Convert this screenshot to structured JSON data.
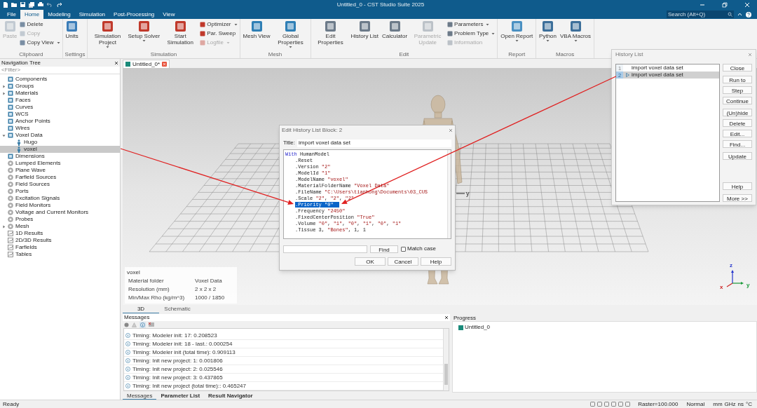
{
  "window": {
    "title": "Untitled_0 - CST Studio Suite 2025",
    "search_placeholder": "Search (Alt+Q)"
  },
  "ribbon_tabs": [
    {
      "label": "File",
      "selected": false
    },
    {
      "label": "Home",
      "selected": true
    },
    {
      "label": "Modeling",
      "selected": false
    },
    {
      "label": "Simulation",
      "selected": false
    },
    {
      "label": "Post-Processing",
      "selected": false
    },
    {
      "label": "View",
      "selected": false
    }
  ],
  "ribbon_groups": [
    {
      "label": "Clipboard",
      "items": [
        {
          "label": "Paste",
          "kind": "large",
          "disabled": true,
          "menu": false
        },
        {
          "label": "Delete",
          "kind": "small",
          "disabled": false,
          "menu": false
        },
        {
          "label": "Copy",
          "kind": "small",
          "disabled": true,
          "menu": false
        },
        {
          "label": "Copy View",
          "kind": "small",
          "disabled": false,
          "menu": true
        }
      ]
    },
    {
      "label": "Settings",
      "items": [
        {
          "label": "Units",
          "kind": "large",
          "disabled": false,
          "menu": false
        }
      ]
    },
    {
      "label": "Simulation",
      "items": [
        {
          "label": "Simulation Project",
          "kind": "large",
          "disabled": false,
          "menu": true
        },
        {
          "label": "Setup Solver",
          "kind": "large",
          "disabled": false,
          "menu": true
        },
        {
          "label": "Start Simulation",
          "kind": "large",
          "disabled": false,
          "menu": false
        },
        {
          "label": "Optimizer",
          "kind": "small",
          "disabled": false,
          "menu": true
        },
        {
          "label": "Par. Sweep",
          "kind": "small",
          "disabled": false,
          "menu": false
        },
        {
          "label": "Logfile",
          "kind": "small",
          "disabled": true,
          "menu": true
        }
      ]
    },
    {
      "label": "Mesh",
      "items": [
        {
          "label": "Mesh View",
          "kind": "large",
          "disabled": false,
          "menu": false
        },
        {
          "label": "Global Properties",
          "kind": "large",
          "disabled": false,
          "menu": true
        }
      ]
    },
    {
      "label": "Edit",
      "items": [
        {
          "label": "Edit Properties",
          "kind": "large",
          "disabled": false,
          "menu": false
        },
        {
          "label": "History List",
          "kind": "large",
          "disabled": false,
          "menu": false
        },
        {
          "label": "Calculator",
          "kind": "large",
          "disabled": false,
          "menu": false
        },
        {
          "label": "Parametric Update",
          "kind": "large",
          "disabled": true,
          "menu": false
        },
        {
          "label": "Parameters",
          "kind": "small",
          "disabled": false,
          "menu": true
        },
        {
          "label": "Problem Type",
          "kind": "small",
          "disabled": false,
          "menu": true
        },
        {
          "label": "Information",
          "kind": "small",
          "disabled": true,
          "menu": false
        }
      ]
    },
    {
      "label": "Report",
      "items": [
        {
          "label": "Open Report",
          "kind": "large",
          "disabled": false,
          "menu": true
        }
      ]
    },
    {
      "label": "Macros",
      "items": [
        {
          "label": "Python",
          "kind": "large",
          "disabled": false,
          "menu": true
        },
        {
          "label": "VBA Macros",
          "kind": "large",
          "disabled": false,
          "menu": true
        }
      ]
    }
  ],
  "navigation_tree": {
    "title": "Navigation Tree",
    "filter_placeholder": "<Filter>",
    "items": [
      {
        "label": "Components",
        "kind": "folder",
        "selected": false
      },
      {
        "label": "Groups",
        "kind": "folder",
        "selected": false,
        "expanded": false
      },
      {
        "label": "Materials",
        "kind": "folder",
        "selected": false,
        "expanded": false
      },
      {
        "label": "Faces",
        "kind": "folder",
        "selected": false
      },
      {
        "label": "Curves",
        "kind": "folder",
        "selected": false
      },
      {
        "label": "WCS",
        "kind": "folder",
        "selected": false
      },
      {
        "label": "Anchor Points",
        "kind": "folder",
        "selected": false
      },
      {
        "label": "Wires",
        "kind": "folder",
        "selected": false
      },
      {
        "label": "Voxel Data",
        "kind": "folder",
        "selected": false,
        "expanded": true,
        "children": [
          {
            "label": "Hugo",
            "kind": "voxel",
            "selected": false
          },
          {
            "label": "voxel",
            "kind": "voxel",
            "selected": true
          }
        ]
      },
      {
        "label": "Dimensions",
        "kind": "folder",
        "selected": false
      },
      {
        "label": "Lumped Elements",
        "kind": "source",
        "selected": false
      },
      {
        "label": "Plane Wave",
        "kind": "source",
        "selected": false
      },
      {
        "label": "Farfield Sources",
        "kind": "source",
        "selected": false
      },
      {
        "label": "Field Sources",
        "kind": "source",
        "selected": false
      },
      {
        "label": "Ports",
        "kind": "source",
        "selected": false
      },
      {
        "label": "Excitation Signals",
        "kind": "source",
        "selected": false
      },
      {
        "label": "Field Monitors",
        "kind": "source",
        "selected": false
      },
      {
        "label": "Voltage and Current Monitors",
        "kind": "source",
        "selected": false
      },
      {
        "label": "Probes",
        "kind": "source",
        "selected": false
      },
      {
        "label": "Mesh",
        "kind": "source",
        "selected": false,
        "expanded": false
      },
      {
        "label": "1D Results",
        "kind": "result",
        "selected": false
      },
      {
        "label": "2D/3D Results",
        "kind": "result",
        "selected": false
      },
      {
        "label": "Farfields",
        "kind": "result",
        "selected": false
      },
      {
        "label": "Tables",
        "kind": "result",
        "selected": false
      }
    ]
  },
  "document_tab": {
    "label": "Untitled_0*"
  },
  "viewport": {
    "axis_label": "y",
    "triad": {
      "z": "z",
      "x": "x",
      "y": "y"
    },
    "info": {
      "title": "voxel",
      "rows": [
        {
          "name": "Material folder",
          "value": "Voxel Data"
        },
        {
          "name": "Resolution (mm)",
          "value": "2 x 2 x 2"
        },
        {
          "name": "Min/Max Rho (kg/m^3)",
          "value": "1000 / 1850"
        }
      ]
    }
  },
  "view_tabs": [
    {
      "label": "3D",
      "selected": true
    },
    {
      "label": "Schematic",
      "selected": false
    }
  ],
  "edit_dialog": {
    "title": "Edit History List Block: 2",
    "title_label": "Title:",
    "title_value": "import voxel data set",
    "code": [
      {
        "keyword": "With",
        "text": "HumanModel",
        "selected": false,
        "children": [
          {
            "text": ".Reset",
            "selected": false
          },
          {
            "text": ".Version \"2\"",
            "selected": false
          },
          {
            "text": ".ModelId \"1\"",
            "selected": false
          },
          {
            "text": ".ModelName \"voxel\"",
            "selected": false
          },
          {
            "text": ".MaterialFolderName \"Voxel Data\"",
            "selected": false
          },
          {
            "text": ".FileName \"C:\\Users\\tianhong\\Documents\\03_CUS",
            "selected": false
          },
          {
            "text": ".Scale \"2\", \"2\", \"2\"",
            "selected": false
          },
          {
            "text": ".Priority \"0\"",
            "selected": true
          },
          {
            "text": ".Frequency \"2450\"",
            "selected": false
          },
          {
            "text": ".FixedCenterPosition \"True\"",
            "selected": false
          },
          {
            "text": ".Volume \"0\", \"1\", \"0\", \"1\", \"0\", \"1\"",
            "selected": false
          },
          {
            "text": ".Tissue 3, \"Bones\", 1, 1",
            "selected": false
          }
        ]
      }
    ],
    "find_button": "Find",
    "match_case": {
      "label": "Match case",
      "checked": false
    },
    "buttons": [
      "OK",
      "Cancel",
      "Help"
    ]
  },
  "history_list": {
    "title": "History List",
    "items": [
      {
        "number": "1",
        "text": "import voxel data set",
        "selected": false,
        "current": false
      },
      {
        "number": "2",
        "text": "import voxel data set",
        "selected": true,
        "current": true
      }
    ],
    "button_groups": [
      [
        "Close"
      ],
      [
        "Run to",
        "Step",
        "Continue"
      ],
      [
        "(Un)hide",
        "Delete",
        "Edit...",
        "Find..."
      ],
      [
        "Update"
      ]
    ],
    "bottom_buttons": [
      "Help",
      "More >>"
    ]
  },
  "messages": {
    "title": "Messages",
    "lines": [
      "Timing: Modeler init: 17: 0.208523",
      "Timing: Modeler init: 18 - last.: 0.000254",
      "Timing: Modeler init (total time): 0.909113",
      "Timing: Init new project: 1: 0.001806",
      "Timing: Init new project: 2: 0.025546",
      "Timing: Init new project: 3: 0.437865",
      "Timing: Init new project (total time):: 0.465247"
    ],
    "tabs": [
      {
        "label": "Messages",
        "selected": true
      },
      {
        "label": "Parameter List",
        "selected": false
      },
      {
        "label": "Result Navigator",
        "selected": false
      }
    ]
  },
  "progress": {
    "title": "Progress",
    "items": [
      "Untitled_0"
    ]
  },
  "status_bar": {
    "text": "Ready",
    "raster": "Raster=100.000",
    "mode": "Normal",
    "units": [
      "mm",
      "GHz",
      "ns",
      "°C"
    ]
  }
}
